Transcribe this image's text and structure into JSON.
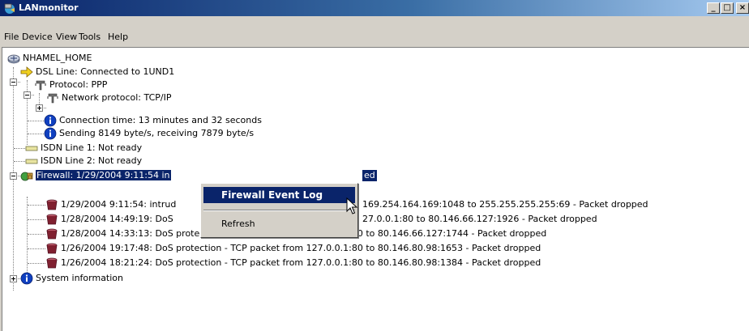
{
  "window": {
    "title": "LANmonitor"
  },
  "window_controls": {
    "minimize": "_",
    "maximize": "□",
    "close": "×"
  },
  "menu": [
    {
      "label": "File"
    },
    {
      "label": "Device"
    },
    {
      "label": "View"
    },
    {
      "label": "Tools"
    },
    {
      "label": "Help"
    }
  ],
  "tree": {
    "root": "NHAMEL_HOME",
    "dsl": "DSL Line: Connected to 1UND1",
    "protocol": "Protocol: PPP",
    "network_protocol": "Network protocol: TCP/IP",
    "connection_time": "Connection time: 13 minutes and 32 seconds",
    "throughput": "Sending 8149 byte/s, receiving 7879 byte/s",
    "isdn1": "ISDN Line 1: Not ready",
    "isdn2": "ISDN Line 2: Not ready",
    "firewall_visible_start": "Firewall: 1/29/2004 9:11:54 in",
    "firewall_visible_end": "ed",
    "events": [
      {
        "visible_start": "1/29/2004 9:11:54: intrud",
        "visible_end": "169.254.164.169:1048 to 255.255.255.255:69 - Packet dropped"
      },
      {
        "visible_start": "1/28/2004 14:49:19: DoS",
        "visible_end": "27.0.0.1:80 to 80.146.66.127:1926 - Packet dropped"
      },
      {
        "text": "1/28/2004 14:33:13: DoS protection - TCP packet from 127.0.0.1:80 to 80.146.66.127:1744 - Packet dropped"
      },
      {
        "text": "1/26/2004 19:17:48: DoS protection - TCP packet from 127.0.0.1:80 to 80.146.80.98:1653 - Packet dropped"
      },
      {
        "text": "1/26/2004 18:21:24: DoS protection - TCP packet from 127.0.0.1:80 to 80.146.80.98:1384 - Packet dropped"
      }
    ],
    "system_info": "System information"
  },
  "context_menu": {
    "items": [
      {
        "label": "Firewall Event Log",
        "highlighted": true
      },
      {
        "label": "Refresh",
        "highlighted": false
      }
    ]
  },
  "colors": {
    "selection": "#0a246a",
    "titlebar_start": "#0a246a",
    "titlebar_end": "#a6caf0",
    "chrome": "#d4d0c8"
  }
}
